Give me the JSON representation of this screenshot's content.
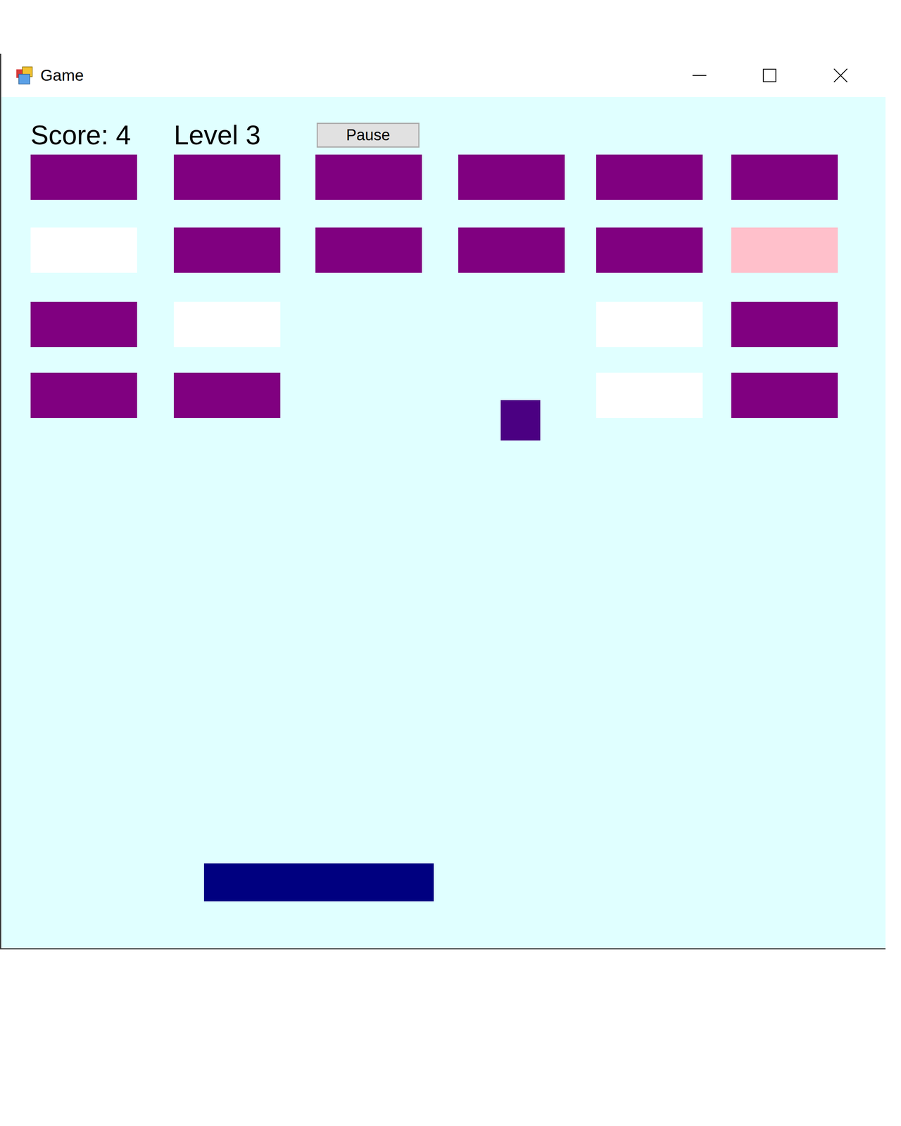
{
  "window": {
    "title": "Game"
  },
  "hud": {
    "score": "Score: 4",
    "level": "Level 3",
    "pause_button": "Pause"
  },
  "bricks": [
    [
      {
        "broken": false,
        "color": "#800080"
      },
      {
        "broken": false,
        "color": "#800080"
      },
      {
        "broken": false,
        "color": "#800080"
      },
      {
        "broken": false,
        "color": "#800080"
      },
      {
        "broken": false,
        "color": "#800080"
      },
      {
        "broken": false,
        "color": "#800080"
      }
    ],
    [
      {
        "broken": false,
        "color": "#ffffff"
      },
      {
        "broken": false,
        "color": "#800080"
      },
      {
        "broken": false,
        "color": "#800080"
      },
      {
        "broken": false,
        "color": "#800080"
      },
      {
        "broken": false,
        "color": "#800080"
      },
      {
        "broken": false,
        "color": "#ffc0cb"
      }
    ],
    [
      {
        "broken": false,
        "color": "#800080"
      },
      {
        "broken": false,
        "color": "#ffffff"
      },
      {
        "broken": true,
        "color": "#800080"
      },
      {
        "broken": true,
        "color": "#800080"
      },
      {
        "broken": false,
        "color": "#ffffff"
      },
      {
        "broken": false,
        "color": "#800080"
      }
    ],
    [
      {
        "broken": false,
        "color": "#800080"
      },
      {
        "broken": false,
        "color": "#800080"
      },
      {
        "broken": true,
        "color": "#800080"
      },
      {
        "broken": true,
        "color": "#800080"
      },
      {
        "broken": false,
        "color": "#ffffff"
      },
      {
        "broken": false,
        "color": "#800080"
      }
    ]
  ]
}
